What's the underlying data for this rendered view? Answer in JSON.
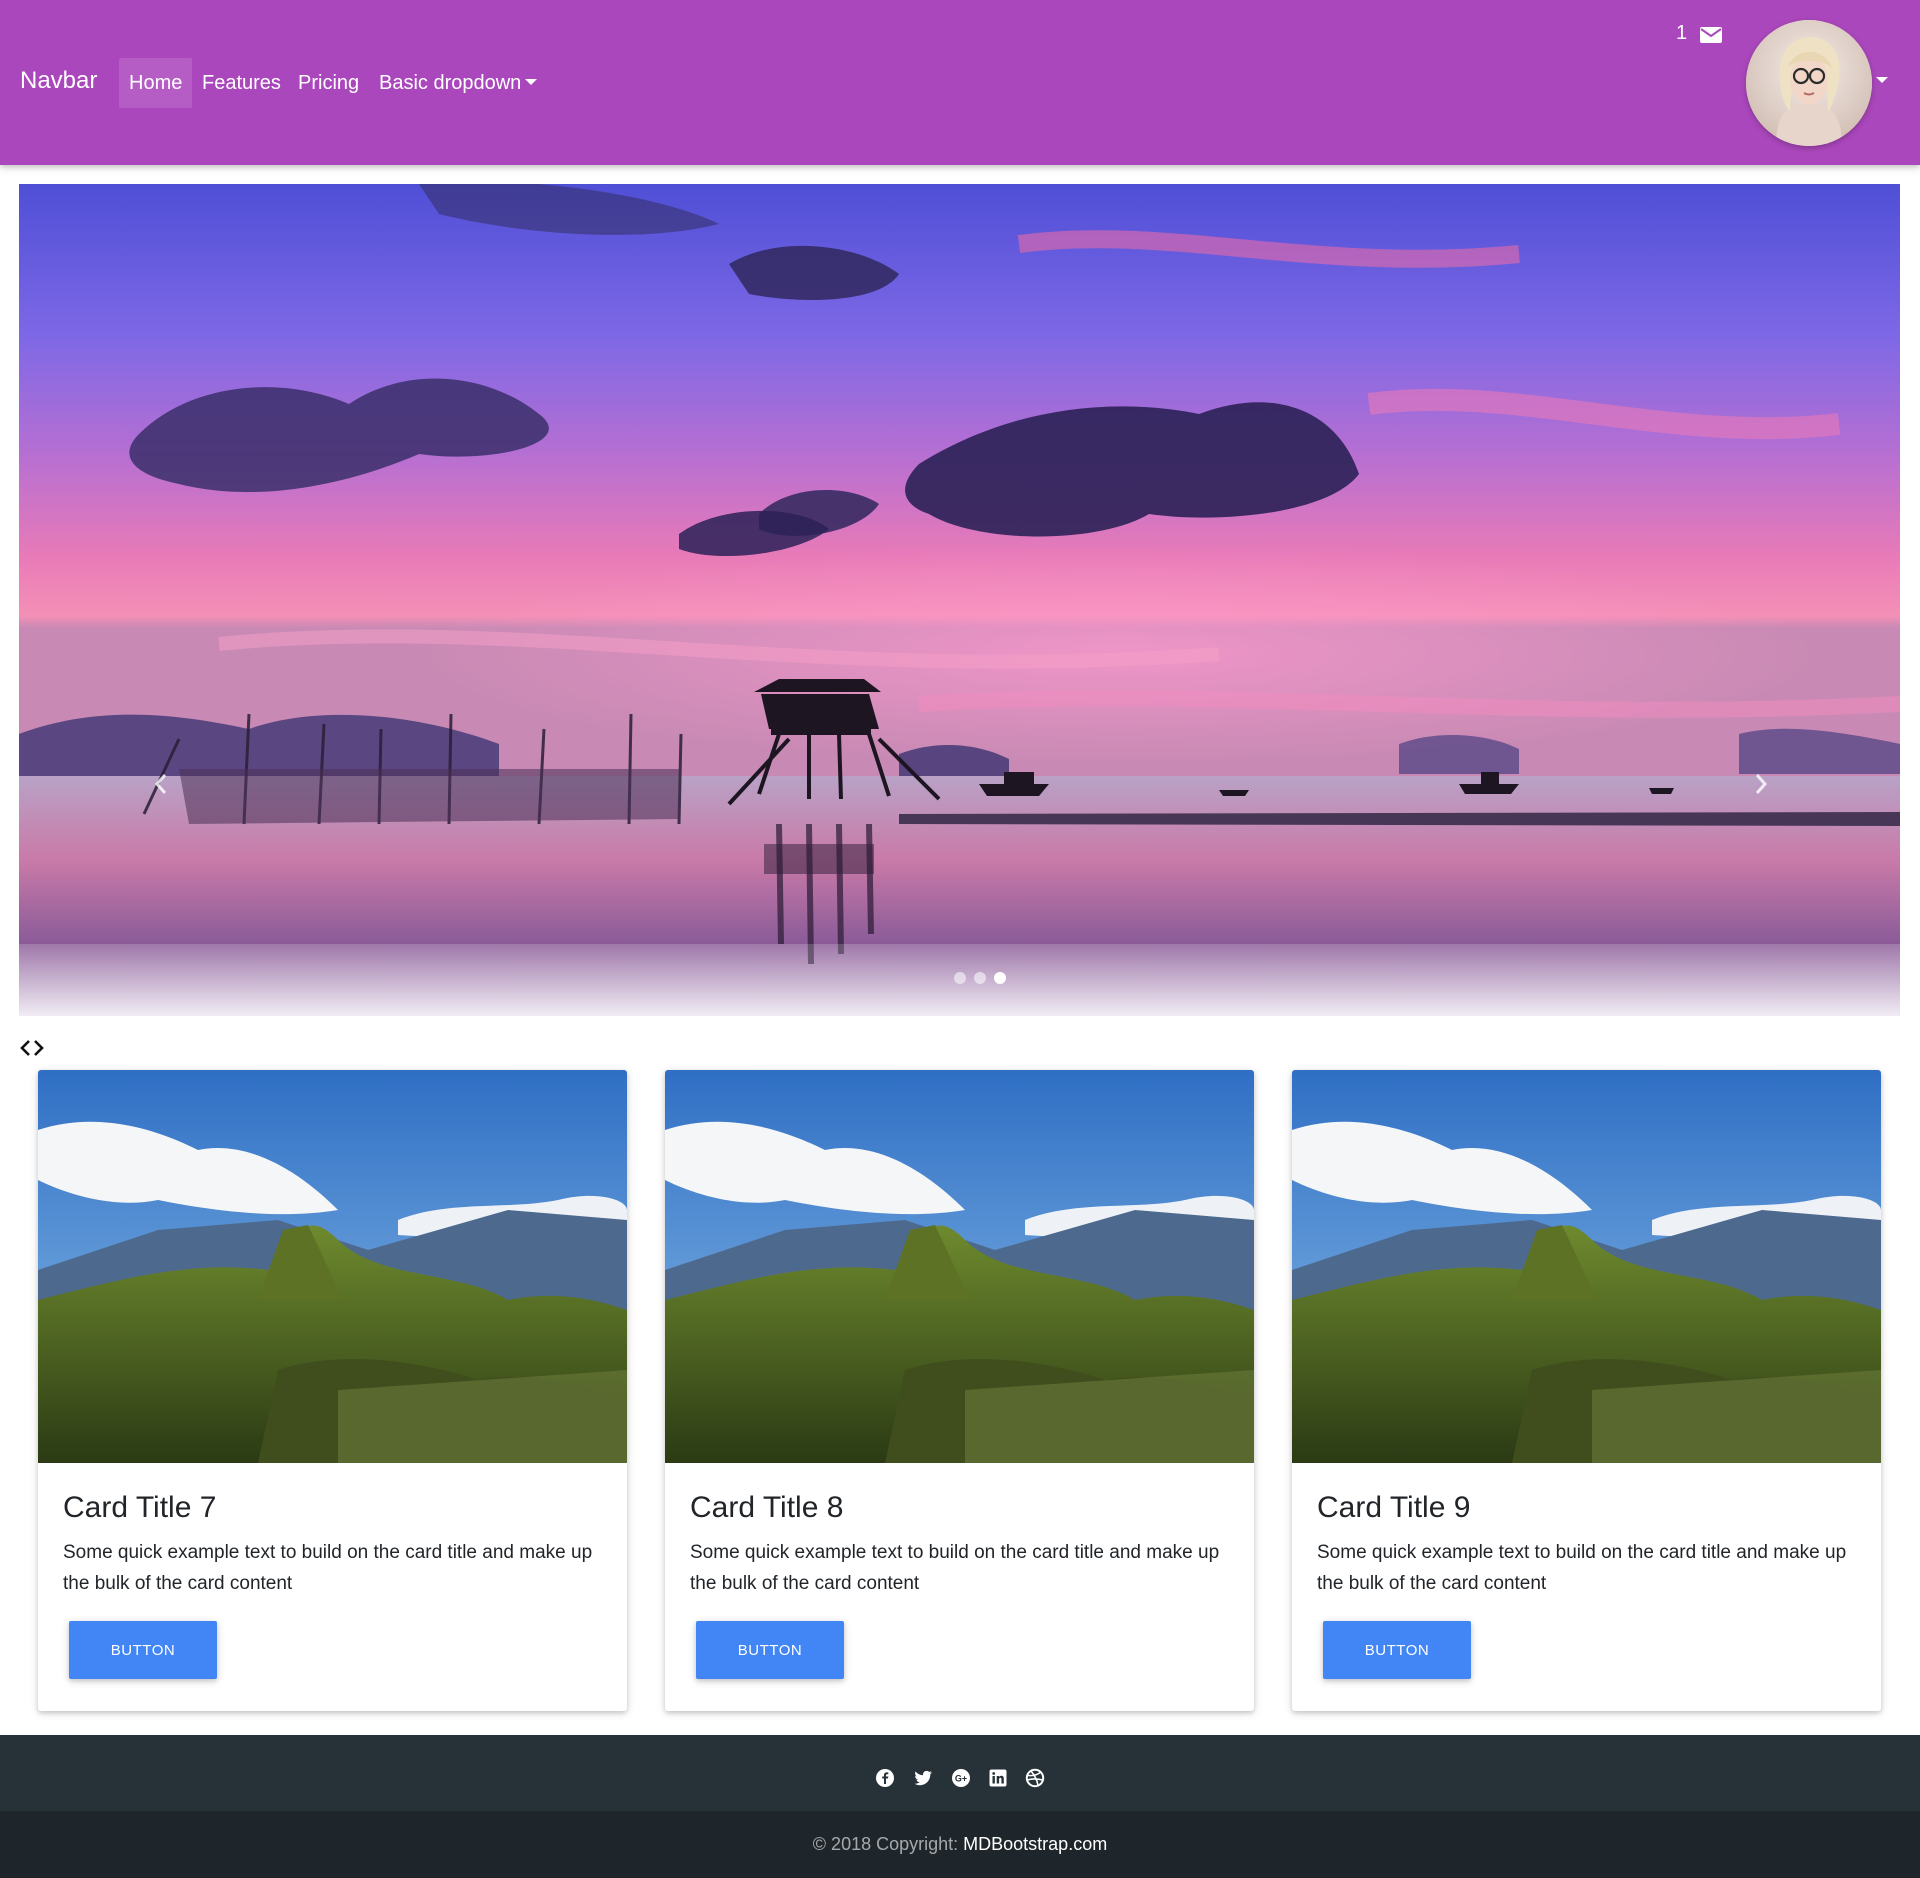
{
  "navbar": {
    "brand": "Navbar",
    "links": [
      {
        "label": "Home"
      },
      {
        "label": "Features"
      },
      {
        "label": "Pricing"
      },
      {
        "label": "Basic dropdown"
      }
    ],
    "mail_count": "1",
    "mail_icon": "envelope-icon",
    "avatar": "user-avatar",
    "background_color": "#ab47bc"
  },
  "carousel": {
    "prev_icon": "chevron-left-icon",
    "next_icon": "chevron-right-icon",
    "slide_count": 3,
    "active_slide": 3
  },
  "cards": [
    {
      "title": "Card Title 7",
      "text": "Some quick example text to build on the card title and make up the bulk of the card content",
      "button": "BUTTON"
    },
    {
      "title": "Card Title 8",
      "text": "Some quick example text to build on the card title and make up the bulk of the card content",
      "button": "BUTTON"
    },
    {
      "title": "Card Title 9",
      "text": "Some quick example text to build on the card title and make up the bulk of the card content",
      "button": "BUTTON"
    }
  ],
  "footer": {
    "social_icons": [
      "facebook-icon",
      "twitter-icon",
      "google-plus-icon",
      "linkedin-icon",
      "dribbble-icon"
    ],
    "copyright": "© 2018 Copyright: ",
    "copyright_link": "MDBootstrap.com"
  },
  "colors": {
    "accent": "#4285f4",
    "footer_top": "#263238",
    "footer_bottom": "#1f262b"
  }
}
